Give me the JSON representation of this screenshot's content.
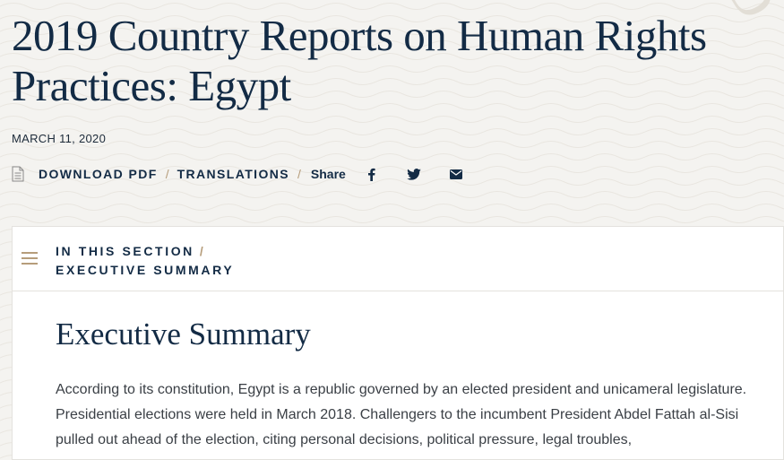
{
  "page": {
    "title": "2019 Country Reports on Human Rights Practices: Egypt",
    "date": "MARCH 11, 2020"
  },
  "actions": {
    "download_pdf": "DOWNLOAD PDF",
    "translations": "TRANSLATIONS",
    "separator": "/",
    "share": "Share",
    "icons": [
      "document-icon",
      "facebook-icon",
      "twitter-icon",
      "email-icon"
    ]
  },
  "section_bar": {
    "label": "IN THIS SECTION",
    "separator": "/",
    "current": "EXECUTIVE SUMMARY"
  },
  "content": {
    "heading": "Executive Summary",
    "paragraph": "According to its constitution, Egypt is a republic governed by an elected president and unicameral legislature. Presidential elections were held in March 2018. Challengers to the incumbent President Abdel Fattah al-Sisi pulled out ahead of the election, citing personal decisions, political pressure, legal troubles,"
  },
  "colors": {
    "navy": "#132b45",
    "accent_tan": "#b69d7b",
    "background": "#f4f3f0",
    "card": "#ffffff"
  }
}
